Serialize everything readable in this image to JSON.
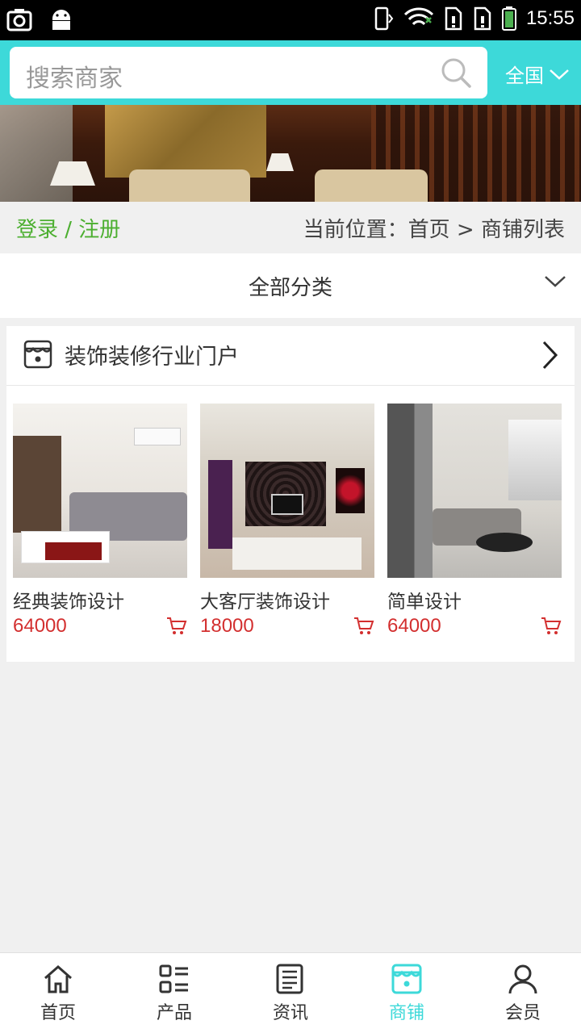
{
  "status_bar": {
    "time": "15:55"
  },
  "search": {
    "placeholder": "搜索商家"
  },
  "region": {
    "label": "全国"
  },
  "location": {
    "login_label": "登录 / 注册",
    "breadcrumb": "当前位置：首页 > 商铺列表"
  },
  "category": {
    "label": "全部分类"
  },
  "shop": {
    "name": "装饰装修行业门户",
    "products": [
      {
        "name": "经典装饰设计",
        "price": "64000"
      },
      {
        "name": "大客厅装饰设计",
        "price": "18000"
      },
      {
        "name": "简单设计",
        "price": "64000"
      }
    ]
  },
  "bottom_nav": {
    "items": [
      {
        "label": "首页",
        "icon": "home-icon"
      },
      {
        "label": "产品",
        "icon": "list-icon"
      },
      {
        "label": "资讯",
        "icon": "news-icon"
      },
      {
        "label": "商铺",
        "icon": "store-icon",
        "active": true
      },
      {
        "label": "会员",
        "icon": "user-icon"
      }
    ]
  },
  "colors": {
    "accent": "#3dd9d9",
    "price": "#d32f2f",
    "login": "#4caf30"
  }
}
